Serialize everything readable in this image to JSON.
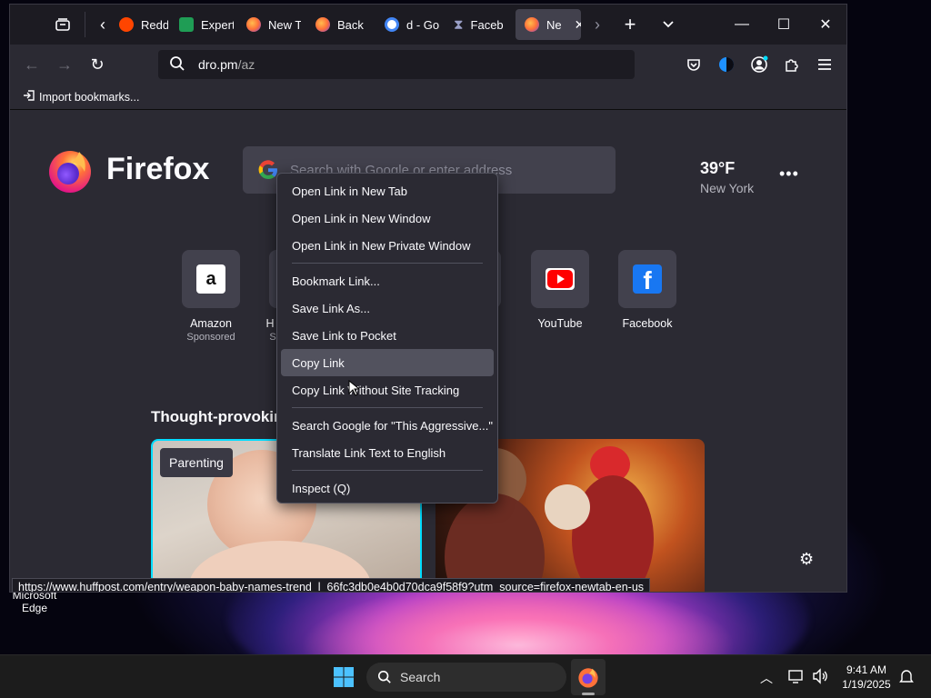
{
  "desktop": {
    "icon_label": "Microsoft Edge"
  },
  "browser": {
    "tabs": [
      {
        "label": "Reddi",
        "favicon_color": "#ff4500"
      },
      {
        "label": "Expert",
        "favicon_color": "#1f9d55"
      },
      {
        "label": "New T",
        "favicon_color": "#ff7139"
      },
      {
        "label": "Back",
        "favicon_color": "#ff7139"
      },
      {
        "label": "d - Go",
        "favicon_color": "#4285f4"
      },
      {
        "label": "Faceb",
        "favicon_color": "#9aa0c8"
      },
      {
        "label": "Ne",
        "favicon_color": "#ff7139",
        "active": true
      }
    ],
    "url": {
      "domain": "dro.pm",
      "path": "/az"
    },
    "bookmarks_bar": {
      "import_label": "Import bookmarks..."
    }
  },
  "newtab": {
    "brand": "Firefox",
    "search_placeholder": "Search with Google or enter address",
    "weather": {
      "temp": "39°F",
      "city": "New York"
    },
    "top_sites": [
      {
        "label": "Amazon",
        "sub": "Sponsored",
        "icon": "amazon-icon"
      },
      {
        "label": "H",
        "sub": "S",
        "icon": "site-icon"
      },
      {
        "label": "YouTube",
        "sub": "",
        "icon": "youtube-icon"
      },
      {
        "label": "Facebook",
        "sub": "",
        "icon": "facebook-icon"
      }
    ],
    "section_title": "Thought-provokin",
    "cards": [
      {
        "tag": "Parenting"
      },
      {
        "tag": ""
      }
    ]
  },
  "status_url": "https://www.huffpost.com/entry/weapon-baby-names-trend_l_66fc3db0e4b0d70dca9f58f9?utm_source=firefox-newtab-en-us",
  "context_menu": {
    "groups": [
      [
        "Open Link in New Tab",
        "Open Link in New Window",
        "Open Link in New Private Window"
      ],
      [
        "Bookmark Link...",
        "Save Link As...",
        "Save Link to Pocket",
        "Copy Link",
        "Copy Link Without Site Tracking"
      ],
      [
        "Search Google for \"This Aggressive...\"",
        "Translate Link Text to English"
      ],
      [
        "Inspect (Q)"
      ]
    ],
    "highlighted": "Copy Link"
  },
  "taskbar": {
    "search_label": "Search",
    "time": "9:41 AM",
    "date": "1/19/2025"
  },
  "colors": {
    "accent": "#00ddff",
    "window_bg": "#1c1b22",
    "content_bg": "#2b2a33",
    "menu_highlight": "#52525e"
  }
}
